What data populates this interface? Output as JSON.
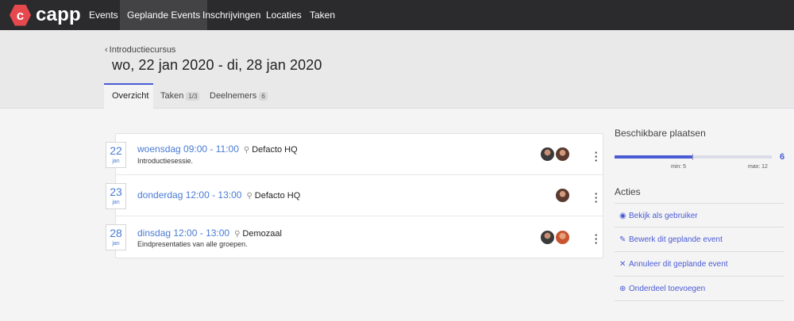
{
  "app": {
    "logo_glyph": "c",
    "name": "capp"
  },
  "nav": [
    {
      "label": "Events"
    },
    {
      "label": "Geplande Events"
    },
    {
      "label": "Inschrijvingen"
    },
    {
      "label": "Locaties"
    },
    {
      "label": "Taken"
    }
  ],
  "header": {
    "back_label": "Introductiecursus",
    "title": "wo, 22 jan 2020 - di, 28 jan 2020"
  },
  "tabs": [
    {
      "label": "Overzicht"
    },
    {
      "label": "Taken",
      "badge": "1/3"
    },
    {
      "label": "Deelnemers",
      "badge": "6"
    }
  ],
  "events": [
    {
      "day": "22",
      "month": "jan",
      "time": "woensdag 09:00 - 11:00",
      "location": "Defacto HQ",
      "description": "Introductiesessie.",
      "avatars": 2
    },
    {
      "day": "23",
      "month": "jan",
      "time": "donderdag 12:00 - 13:00",
      "location": "Defacto HQ",
      "description": "",
      "avatars": 1
    },
    {
      "day": "28",
      "month": "jan",
      "time": "dinsdag 12:00 - 13:00",
      "location": "Demozaal",
      "description": "Eindpresentaties van alle groepen.",
      "avatars": 2
    }
  ],
  "capacity": {
    "heading": "Beschikbare plaatsen",
    "value": "6",
    "min_label": "min: 5",
    "max_label": "max: 12",
    "fill_fraction": 0.5
  },
  "actions": {
    "heading": "Acties",
    "items": [
      {
        "label": "Bekijk als gebruiker",
        "icon": "eye-icon"
      },
      {
        "label": "Bewerk dit geplande event",
        "icon": "pencil-icon"
      },
      {
        "label": "Annuleer dit geplande event",
        "icon": "close-icon"
      },
      {
        "label": "Onderdeel toevoegen",
        "icon": "plus-circle-icon"
      }
    ]
  },
  "colors": {
    "accent": "#4a5bd4",
    "link": "#4a7bd4",
    "brand": "#e5484d",
    "topbar": "#2b2b2d"
  }
}
